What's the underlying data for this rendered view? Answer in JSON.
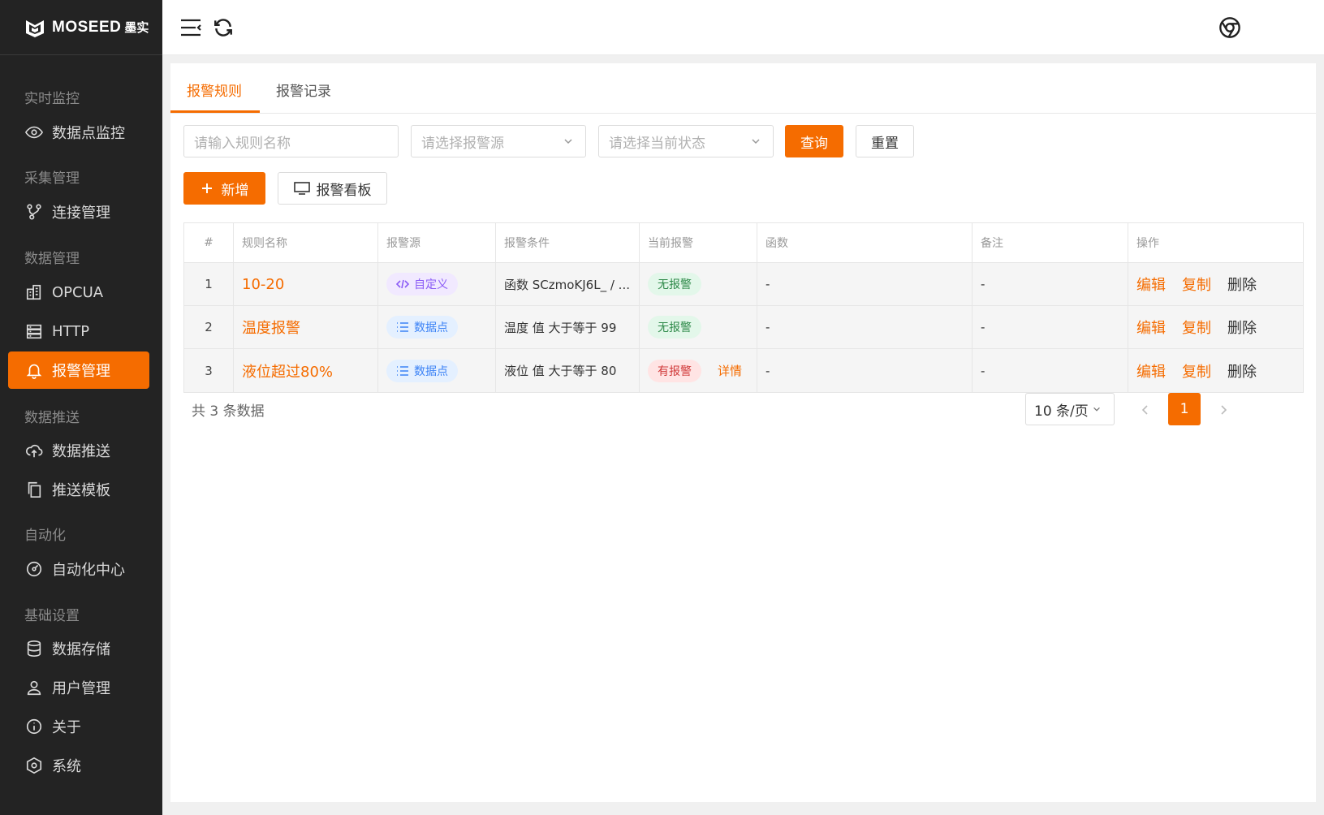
{
  "brand": {
    "name": "MOSEED",
    "cn": "墨实"
  },
  "sidebar": {
    "groups": [
      "实时监控",
      "采集管理",
      "数据管理",
      "数据推送",
      "自动化",
      "基础设置"
    ],
    "items": [
      {
        "label": "数据点监控",
        "icon": "eye-icon"
      },
      {
        "label": "连接管理",
        "icon": "branch-icon"
      },
      {
        "label": "OPCUA",
        "icon": "building-icon"
      },
      {
        "label": "HTTP",
        "icon": "server-icon"
      },
      {
        "label": "报警管理",
        "icon": "bell-icon"
      },
      {
        "label": "数据推送",
        "icon": "cloud-upload-icon"
      },
      {
        "label": "推送模板",
        "icon": "copy-icon"
      },
      {
        "label": "自动化中心",
        "icon": "gauge-icon"
      },
      {
        "label": "数据存储",
        "icon": "database-icon"
      },
      {
        "label": "用户管理",
        "icon": "user-icon"
      },
      {
        "label": "关于",
        "icon": "info-icon"
      },
      {
        "label": "系统",
        "icon": "hexagon-icon"
      }
    ]
  },
  "tabs": [
    "报警规则",
    "报警记录"
  ],
  "filters": {
    "name_placeholder": "请输入规则名称",
    "source_placeholder": "请选择报警源",
    "status_placeholder": "请选择当前状态",
    "query_label": "查询",
    "reset_label": "重置"
  },
  "actions": {
    "add_label": "新增",
    "board_label": "报警看板"
  },
  "table": {
    "headers": [
      "#",
      "规则名称",
      "报警源",
      "报警条件",
      "当前报警",
      "函数",
      "备注",
      "操作"
    ],
    "rows": [
      {
        "idx": "1",
        "name": "10-20",
        "source": "自定义",
        "condition": "函数 SCzmoKJ6L_ / ...",
        "status": "无报警",
        "detail": "",
        "func": "-",
        "note": "-"
      },
      {
        "idx": "2",
        "name": "温度报警",
        "source": "数据点",
        "condition": "温度 值 大于等于 99",
        "status": "无报警",
        "detail": "",
        "func": "-",
        "note": "-"
      },
      {
        "idx": "3",
        "name": "液位超过80%",
        "source": "数据点",
        "condition": "液位 值 大于等于 80",
        "status": "有报警",
        "detail": "详情",
        "func": "-",
        "note": "-"
      }
    ],
    "ops": {
      "edit": "编辑",
      "copy": "复制",
      "delete": "删除"
    }
  },
  "pagination": {
    "total_text": "共 3 条数据",
    "page_size": "10 条/页",
    "current_page": "1"
  },
  "colors": {
    "accent": "#f56c00",
    "sidebar_bg": "#232323"
  }
}
